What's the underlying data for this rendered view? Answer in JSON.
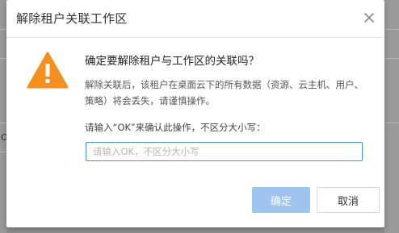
{
  "dialog": {
    "title": "解除租户关联工作区",
    "close_icon": "close-icon",
    "warning_icon": "warning-triangle-icon",
    "question": "确定要解除租户与工作区的关联吗？",
    "description": "解除关联后，该租户在桌面云下的所有数据（资源、云主机、用户、策略）将会丢失，请谨慎操作。",
    "input_label": "请输入“OK”来确认此操作，不区分大小写：",
    "input_placeholder": "请输入OK，不区分大小写",
    "input_value": "",
    "confirm_label": "确定",
    "cancel_label": "取消"
  },
  "background": {
    "partial_char": "O"
  },
  "colors": {
    "warning": "#f5901e",
    "primary_disabled": "#9fc4f0",
    "input_focus_border": "#3d8ee8"
  }
}
